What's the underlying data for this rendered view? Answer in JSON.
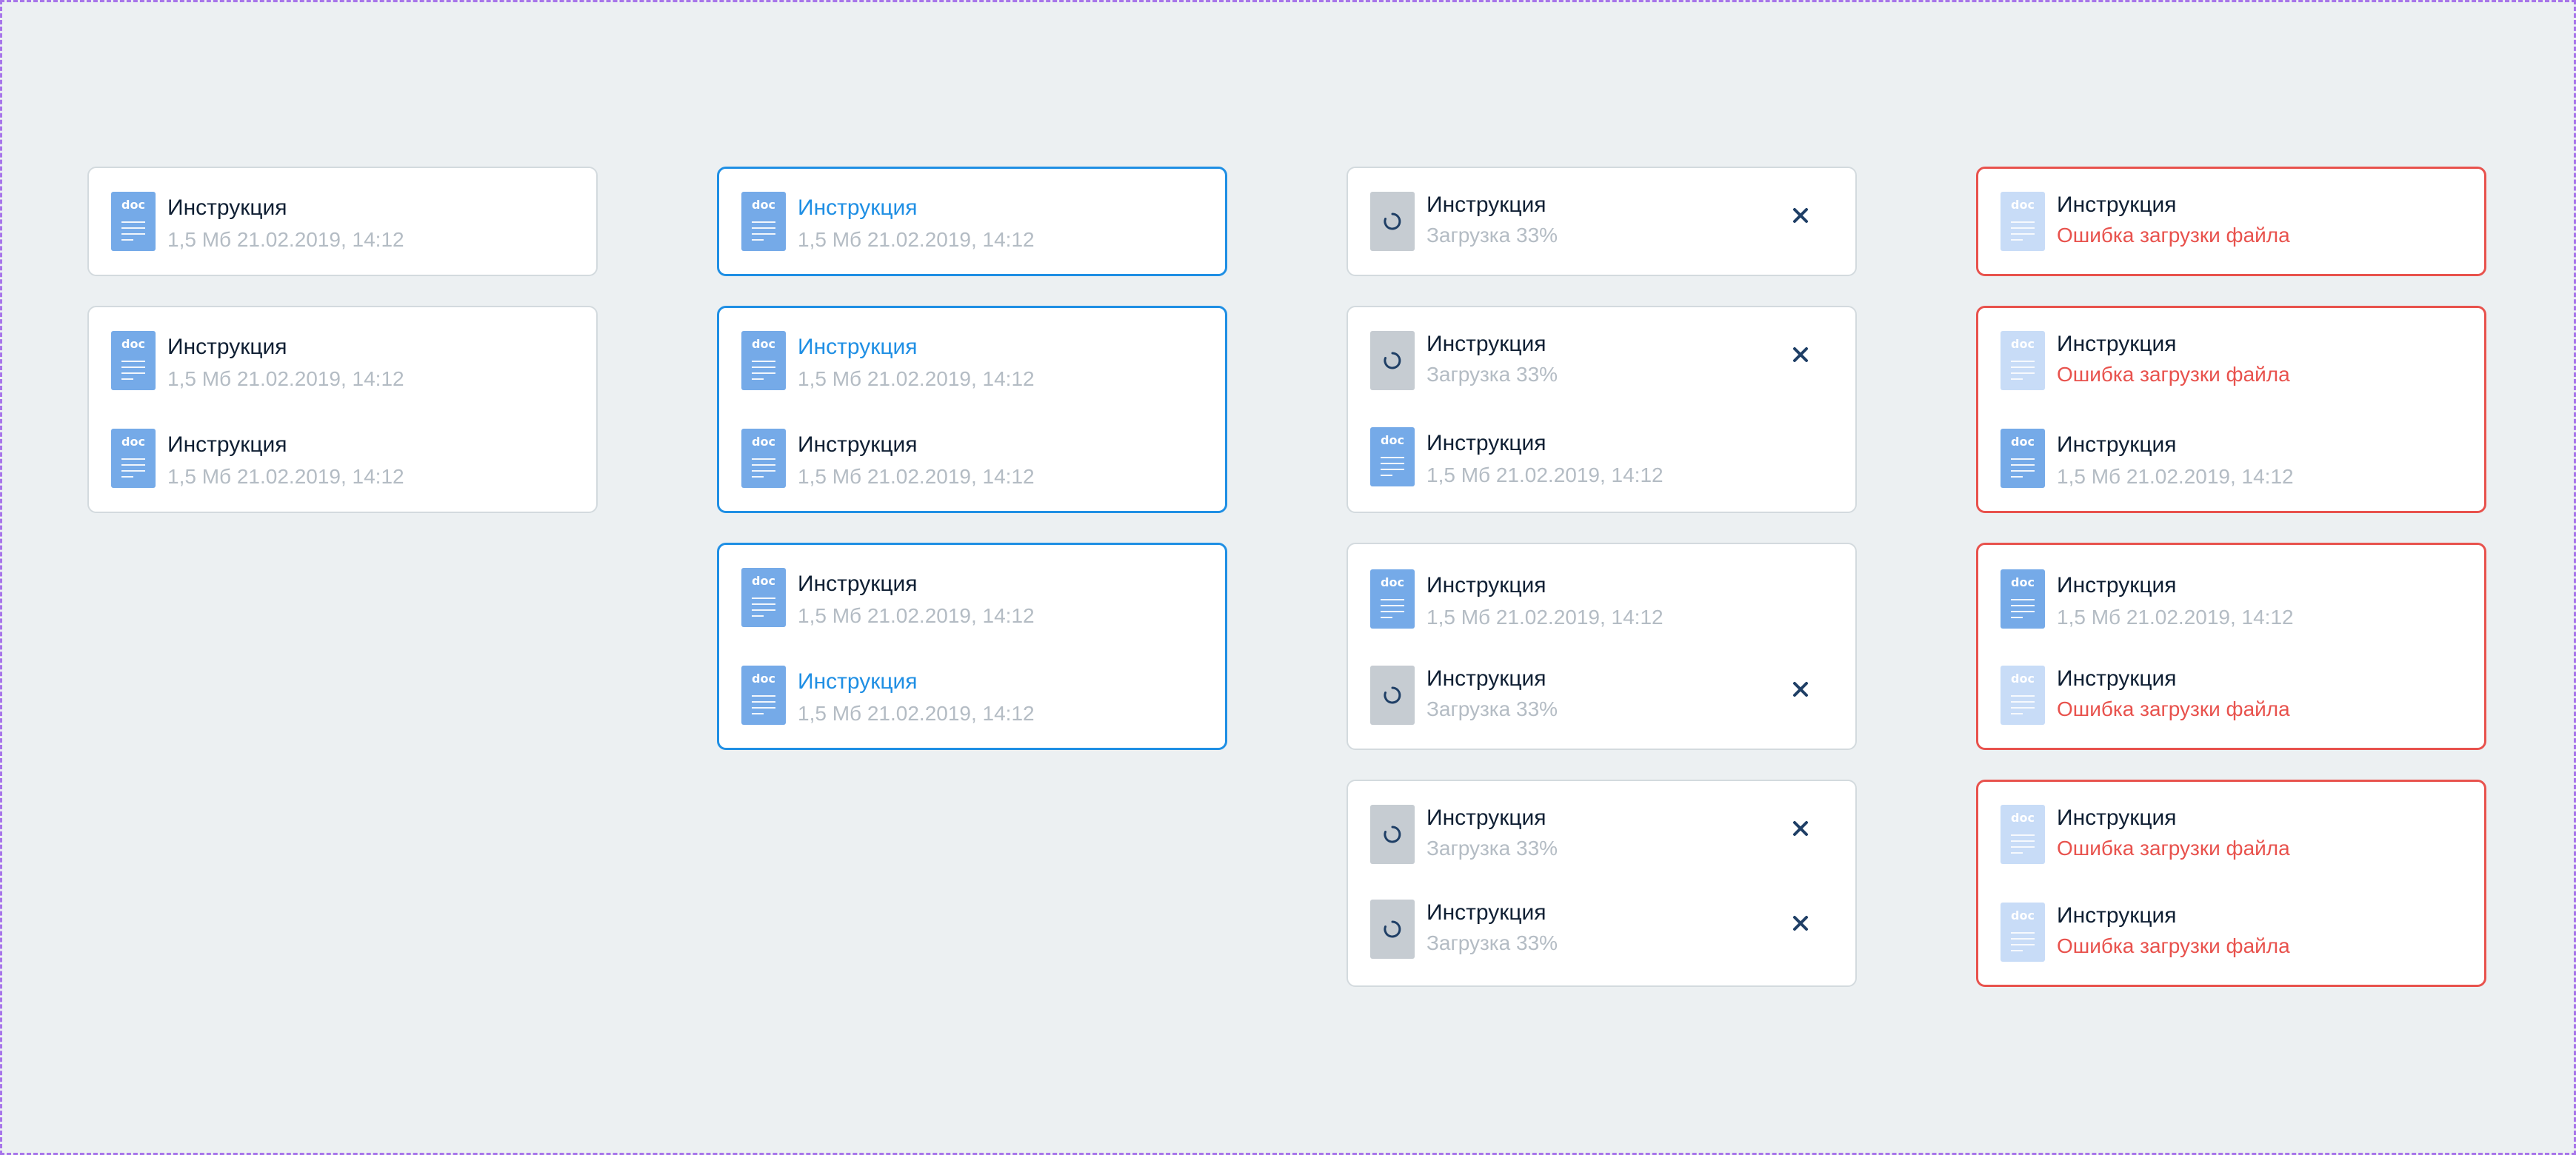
{
  "colors": {
    "background": "#ecf0f2",
    "frame_border": "#a774ea",
    "card_border": "#d3dade",
    "selected": "#1f8fe4",
    "error": "#e8524d",
    "doc_icon": "#75aae8",
    "doc_icon_faded": "#c8dcf7",
    "muted_text": "#b4bcc4",
    "spinner_bg": "#c6ccd2",
    "close_icon": "#1f3f66"
  },
  "file": {
    "icon_tag": "doc",
    "name": "Инструкция",
    "size": "1,5 Мб",
    "date": "21.02.2019, 14:12",
    "meta": "1,5 Мб  21.02.2019, 14:12"
  },
  "upload": {
    "progress_percent": 33,
    "status": "Загрузка 33%"
  },
  "error": {
    "message": "Ошибка загрузки файла"
  },
  "columns": [
    {
      "variant": "default",
      "cards": [
        [
          {
            "state": "default"
          }
        ],
        [
          {
            "state": "default"
          },
          {
            "state": "default"
          }
        ]
      ]
    },
    {
      "variant": "selected",
      "cards": [
        [
          {
            "state": "selected"
          }
        ],
        [
          {
            "state": "selected"
          },
          {
            "state": "default"
          }
        ],
        [
          {
            "state": "default"
          },
          {
            "state": "selected"
          }
        ]
      ]
    },
    {
      "variant": "uploading",
      "cards": [
        [
          {
            "state": "uploading"
          }
        ],
        [
          {
            "state": "uploading"
          },
          {
            "state": "default"
          }
        ],
        [
          {
            "state": "default"
          },
          {
            "state": "uploading"
          }
        ],
        [
          {
            "state": "uploading"
          },
          {
            "state": "uploading"
          }
        ]
      ]
    },
    {
      "variant": "error",
      "cards": [
        [
          {
            "state": "error"
          }
        ],
        [
          {
            "state": "error"
          },
          {
            "state": "default"
          }
        ],
        [
          {
            "state": "default"
          },
          {
            "state": "error"
          }
        ],
        [
          {
            "state": "error"
          },
          {
            "state": "error"
          }
        ]
      ]
    }
  ]
}
